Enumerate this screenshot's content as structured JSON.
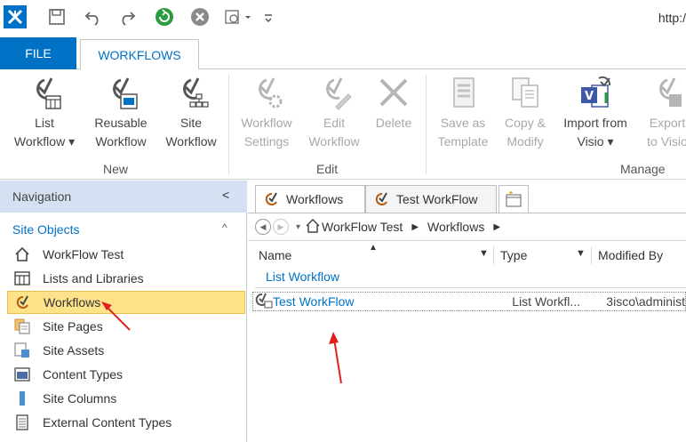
{
  "qat": {
    "url": "http:/",
    "icons": [
      "app-logo-icon",
      "save-icon",
      "undo-icon",
      "redo-icon",
      "refresh-icon",
      "stop-icon",
      "preview-icon",
      "customize-qat-icon"
    ]
  },
  "tabs": {
    "file": "FILE",
    "workflows": "WORKFLOWS"
  },
  "ribbon": {
    "new_group": {
      "label": "New",
      "list_workflow": [
        "List",
        "Workflow ▾"
      ],
      "reusable_workflow": [
        "Reusable",
        "Workflow"
      ],
      "site_workflow": [
        "Site",
        "Workflow"
      ]
    },
    "edit_group": {
      "label": "Edit",
      "workflow_settings": [
        "Workflow",
        "Settings"
      ],
      "edit_workflow": [
        "Edit",
        "Workflow"
      ],
      "delete": [
        "Delete",
        ""
      ]
    },
    "manage_group": {
      "label": "Manage",
      "save_as_template": [
        "Save as",
        "Template"
      ],
      "copy_modify": [
        "Copy &",
        "Modify"
      ],
      "import_visio": [
        "Import from",
        "Visio ▾"
      ],
      "export_visio": [
        "Export",
        "to Visio"
      ]
    }
  },
  "nav": {
    "title": "Navigation",
    "collapse_glyph": "<",
    "section": "Site Objects",
    "section_glyph": "^",
    "items": [
      {
        "label": "WorkFlow Test",
        "icon": "home-icon"
      },
      {
        "label": "Lists and Libraries",
        "icon": "list-icon"
      },
      {
        "label": "Workflows",
        "icon": "workflow-icon",
        "selected": true
      },
      {
        "label": "Site Pages",
        "icon": "pages-icon"
      },
      {
        "label": "Site Assets",
        "icon": "assets-icon"
      },
      {
        "label": "Content Types",
        "icon": "content-types-icon"
      },
      {
        "label": "Site Columns",
        "icon": "columns-icon"
      },
      {
        "label": "External Content Types",
        "icon": "external-content-icon"
      }
    ]
  },
  "doc": {
    "tabs": [
      "Workflows",
      "Test WorkFlow"
    ],
    "breadcrumb": [
      "WorkFlow Test",
      "Workflows"
    ],
    "columns": {
      "name": "Name",
      "type": "Type",
      "modified_by": "Modified By"
    },
    "group": "List Workflow",
    "rows": [
      {
        "name": "Test WorkFlow",
        "type": "List Workfl...",
        "modified_by": "3isco\\administ"
      }
    ]
  },
  "colors": {
    "accent": "#0072c6",
    "selection": "#fde28a",
    "nav_header": "#d5e1f2",
    "arrow": "#e0201c"
  }
}
